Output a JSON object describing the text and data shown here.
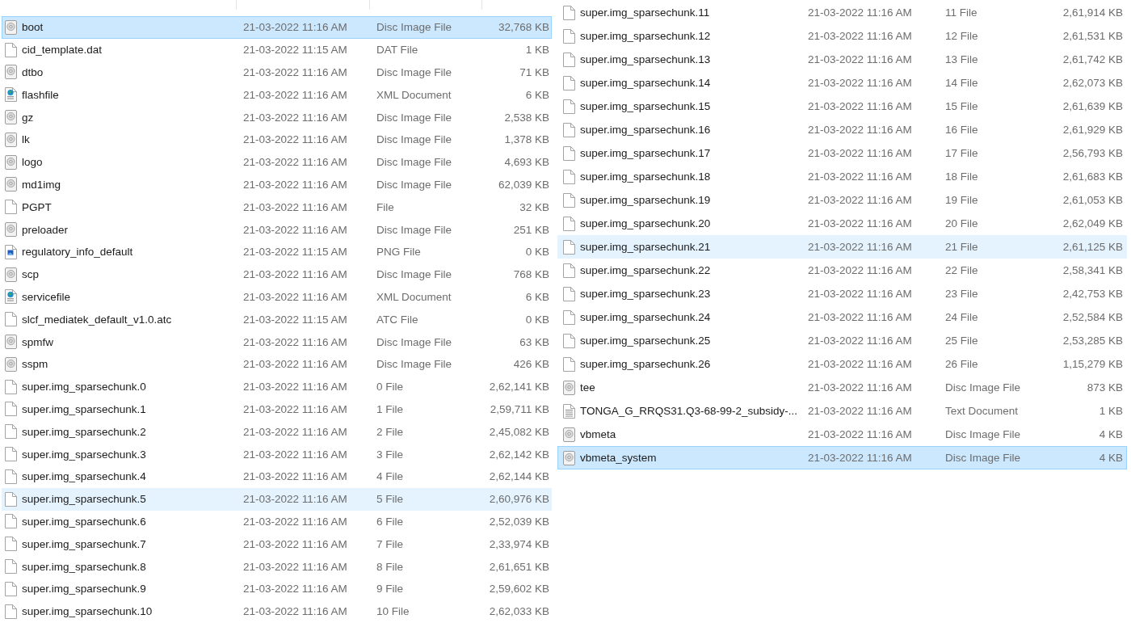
{
  "left_pane": {
    "rows": [
      {
        "name": "boot",
        "date_modified": "21-03-2022 11:16 AM",
        "type": "Disc Image File",
        "size": "32,768 KB",
        "kind": "disc",
        "selected": true,
        "hovered": false
      },
      {
        "name": "cid_template.dat",
        "date_modified": "21-03-2022 11:15 AM",
        "type": "DAT File",
        "size": "1 KB",
        "kind": "file",
        "selected": false,
        "hovered": false
      },
      {
        "name": "dtbo",
        "date_modified": "21-03-2022 11:16 AM",
        "type": "Disc Image File",
        "size": "71 KB",
        "kind": "disc",
        "selected": false,
        "hovered": false
      },
      {
        "name": "flashfile",
        "date_modified": "21-03-2022 11:16 AM",
        "type": "XML Document",
        "size": "6 KB",
        "kind": "xml",
        "selected": false,
        "hovered": false
      },
      {
        "name": "gz",
        "date_modified": "21-03-2022 11:16 AM",
        "type": "Disc Image File",
        "size": "2,538 KB",
        "kind": "disc",
        "selected": false,
        "hovered": false
      },
      {
        "name": "lk",
        "date_modified": "21-03-2022 11:16 AM",
        "type": "Disc Image File",
        "size": "1,378 KB",
        "kind": "disc",
        "selected": false,
        "hovered": false
      },
      {
        "name": "logo",
        "date_modified": "21-03-2022 11:16 AM",
        "type": "Disc Image File",
        "size": "4,693 KB",
        "kind": "disc",
        "selected": false,
        "hovered": false
      },
      {
        "name": "md1img",
        "date_modified": "21-03-2022 11:16 AM",
        "type": "Disc Image File",
        "size": "62,039 KB",
        "kind": "disc",
        "selected": false,
        "hovered": false
      },
      {
        "name": "PGPT",
        "date_modified": "21-03-2022 11:16 AM",
        "type": "File",
        "size": "32 KB",
        "kind": "file",
        "selected": false,
        "hovered": false
      },
      {
        "name": "preloader",
        "date_modified": "21-03-2022 11:16 AM",
        "type": "Disc Image File",
        "size": "251 KB",
        "kind": "disc",
        "selected": false,
        "hovered": false
      },
      {
        "name": "regulatory_info_default",
        "date_modified": "21-03-2022 11:15 AM",
        "type": "PNG File",
        "size": "0 KB",
        "kind": "image",
        "selected": false,
        "hovered": false
      },
      {
        "name": "scp",
        "date_modified": "21-03-2022 11:16 AM",
        "type": "Disc Image File",
        "size": "768 KB",
        "kind": "disc",
        "selected": false,
        "hovered": false
      },
      {
        "name": "servicefile",
        "date_modified": "21-03-2022 11:16 AM",
        "type": "XML Document",
        "size": "6 KB",
        "kind": "xml",
        "selected": false,
        "hovered": false
      },
      {
        "name": "slcf_mediatek_default_v1.0.atc",
        "date_modified": "21-03-2022 11:15 AM",
        "type": "ATC File",
        "size": "0 KB",
        "kind": "file",
        "selected": false,
        "hovered": false
      },
      {
        "name": "spmfw",
        "date_modified": "21-03-2022 11:16 AM",
        "type": "Disc Image File",
        "size": "63 KB",
        "kind": "disc",
        "selected": false,
        "hovered": false
      },
      {
        "name": "sspm",
        "date_modified": "21-03-2022 11:16 AM",
        "type": "Disc Image File",
        "size": "426 KB",
        "kind": "disc",
        "selected": false,
        "hovered": false
      },
      {
        "name": "super.img_sparsechunk.0",
        "date_modified": "21-03-2022 11:16 AM",
        "type": "0 File",
        "size": "2,62,141 KB",
        "kind": "file",
        "selected": false,
        "hovered": false
      },
      {
        "name": "super.img_sparsechunk.1",
        "date_modified": "21-03-2022 11:16 AM",
        "type": "1 File",
        "size": "2,59,711 KB",
        "kind": "file",
        "selected": false,
        "hovered": false
      },
      {
        "name": "super.img_sparsechunk.2",
        "date_modified": "21-03-2022 11:16 AM",
        "type": "2 File",
        "size": "2,45,082 KB",
        "kind": "file",
        "selected": false,
        "hovered": false
      },
      {
        "name": "super.img_sparsechunk.3",
        "date_modified": "21-03-2022 11:16 AM",
        "type": "3 File",
        "size": "2,62,142 KB",
        "kind": "file",
        "selected": false,
        "hovered": false
      },
      {
        "name": "super.img_sparsechunk.4",
        "date_modified": "21-03-2022 11:16 AM",
        "type": "4 File",
        "size": "2,62,144 KB",
        "kind": "file",
        "selected": false,
        "hovered": false
      },
      {
        "name": "super.img_sparsechunk.5",
        "date_modified": "21-03-2022 11:16 AM",
        "type": "5 File",
        "size": "2,60,976 KB",
        "kind": "file",
        "selected": false,
        "hovered": true
      },
      {
        "name": "super.img_sparsechunk.6",
        "date_modified": "21-03-2022 11:16 AM",
        "type": "6 File",
        "size": "2,52,039 KB",
        "kind": "file",
        "selected": false,
        "hovered": false
      },
      {
        "name": "super.img_sparsechunk.7",
        "date_modified": "21-03-2022 11:16 AM",
        "type": "7 File",
        "size": "2,33,974 KB",
        "kind": "file",
        "selected": false,
        "hovered": false
      },
      {
        "name": "super.img_sparsechunk.8",
        "date_modified": "21-03-2022 11:16 AM",
        "type": "8 File",
        "size": "2,61,651 KB",
        "kind": "file",
        "selected": false,
        "hovered": false
      },
      {
        "name": "super.img_sparsechunk.9",
        "date_modified": "21-03-2022 11:16 AM",
        "type": "9 File",
        "size": "2,59,602 KB",
        "kind": "file",
        "selected": false,
        "hovered": false
      },
      {
        "name": "super.img_sparsechunk.10",
        "date_modified": "21-03-2022 11:16 AM",
        "type": "10 File",
        "size": "2,62,033 KB",
        "kind": "file",
        "selected": false,
        "hovered": false
      }
    ]
  },
  "right_pane": {
    "rows": [
      {
        "name": "super.img_sparsechunk.11",
        "date_modified": "21-03-2022 11:16 AM",
        "type": "11 File",
        "size": "2,61,914 KB",
        "kind": "file",
        "selected": false,
        "hovered": false
      },
      {
        "name": "super.img_sparsechunk.12",
        "date_modified": "21-03-2022 11:16 AM",
        "type": "12 File",
        "size": "2,61,531 KB",
        "kind": "file",
        "selected": false,
        "hovered": false
      },
      {
        "name": "super.img_sparsechunk.13",
        "date_modified": "21-03-2022 11:16 AM",
        "type": "13 File",
        "size": "2,61,742 KB",
        "kind": "file",
        "selected": false,
        "hovered": false
      },
      {
        "name": "super.img_sparsechunk.14",
        "date_modified": "21-03-2022 11:16 AM",
        "type": "14 File",
        "size": "2,62,073 KB",
        "kind": "file",
        "selected": false,
        "hovered": false
      },
      {
        "name": "super.img_sparsechunk.15",
        "date_modified": "21-03-2022 11:16 AM",
        "type": "15 File",
        "size": "2,61,639 KB",
        "kind": "file",
        "selected": false,
        "hovered": false
      },
      {
        "name": "super.img_sparsechunk.16",
        "date_modified": "21-03-2022 11:16 AM",
        "type": "16 File",
        "size": "2,61,929 KB",
        "kind": "file",
        "selected": false,
        "hovered": false
      },
      {
        "name": "super.img_sparsechunk.17",
        "date_modified": "21-03-2022 11:16 AM",
        "type": "17 File",
        "size": "2,56,793 KB",
        "kind": "file",
        "selected": false,
        "hovered": false
      },
      {
        "name": "super.img_sparsechunk.18",
        "date_modified": "21-03-2022 11:16 AM",
        "type": "18 File",
        "size": "2,61,683 KB",
        "kind": "file",
        "selected": false,
        "hovered": false
      },
      {
        "name": "super.img_sparsechunk.19",
        "date_modified": "21-03-2022 11:16 AM",
        "type": "19 File",
        "size": "2,61,053 KB",
        "kind": "file",
        "selected": false,
        "hovered": false
      },
      {
        "name": "super.img_sparsechunk.20",
        "date_modified": "21-03-2022 11:16 AM",
        "type": "20 File",
        "size": "2,62,049 KB",
        "kind": "file",
        "selected": false,
        "hovered": false
      },
      {
        "name": "super.img_sparsechunk.21",
        "date_modified": "21-03-2022 11:16 AM",
        "type": "21 File",
        "size": "2,61,125 KB",
        "kind": "file",
        "selected": false,
        "hovered": true
      },
      {
        "name": "super.img_sparsechunk.22",
        "date_modified": "21-03-2022 11:16 AM",
        "type": "22 File",
        "size": "2,58,341 KB",
        "kind": "file",
        "selected": false,
        "hovered": false
      },
      {
        "name": "super.img_sparsechunk.23",
        "date_modified": "21-03-2022 11:16 AM",
        "type": "23 File",
        "size": "2,42,753 KB",
        "kind": "file",
        "selected": false,
        "hovered": false
      },
      {
        "name": "super.img_sparsechunk.24",
        "date_modified": "21-03-2022 11:16 AM",
        "type": "24 File",
        "size": "2,52,584 KB",
        "kind": "file",
        "selected": false,
        "hovered": false
      },
      {
        "name": "super.img_sparsechunk.25",
        "date_modified": "21-03-2022 11:16 AM",
        "type": "25 File",
        "size": "2,53,285 KB",
        "kind": "file",
        "selected": false,
        "hovered": false
      },
      {
        "name": "super.img_sparsechunk.26",
        "date_modified": "21-03-2022 11:16 AM",
        "type": "26 File",
        "size": "1,15,279 KB",
        "kind": "file",
        "selected": false,
        "hovered": false
      },
      {
        "name": "tee",
        "date_modified": "21-03-2022 11:16 AM",
        "type": "Disc Image File",
        "size": "873 KB",
        "kind": "disc",
        "selected": false,
        "hovered": false
      },
      {
        "name": "TONGA_G_RRQS31.Q3-68-99-2_subsidy-...",
        "date_modified": "21-03-2022 11:16 AM",
        "type": "Text Document",
        "size": "1 KB",
        "kind": "text",
        "selected": false,
        "hovered": false
      },
      {
        "name": "vbmeta",
        "date_modified": "21-03-2022 11:16 AM",
        "type": "Disc Image File",
        "size": "4 KB",
        "kind": "disc",
        "selected": false,
        "hovered": false
      },
      {
        "name": "vbmeta_system",
        "date_modified": "21-03-2022 11:16 AM",
        "type": "Disc Image File",
        "size": "4 KB",
        "kind": "disc",
        "selected": true,
        "hovered": false
      }
    ]
  }
}
